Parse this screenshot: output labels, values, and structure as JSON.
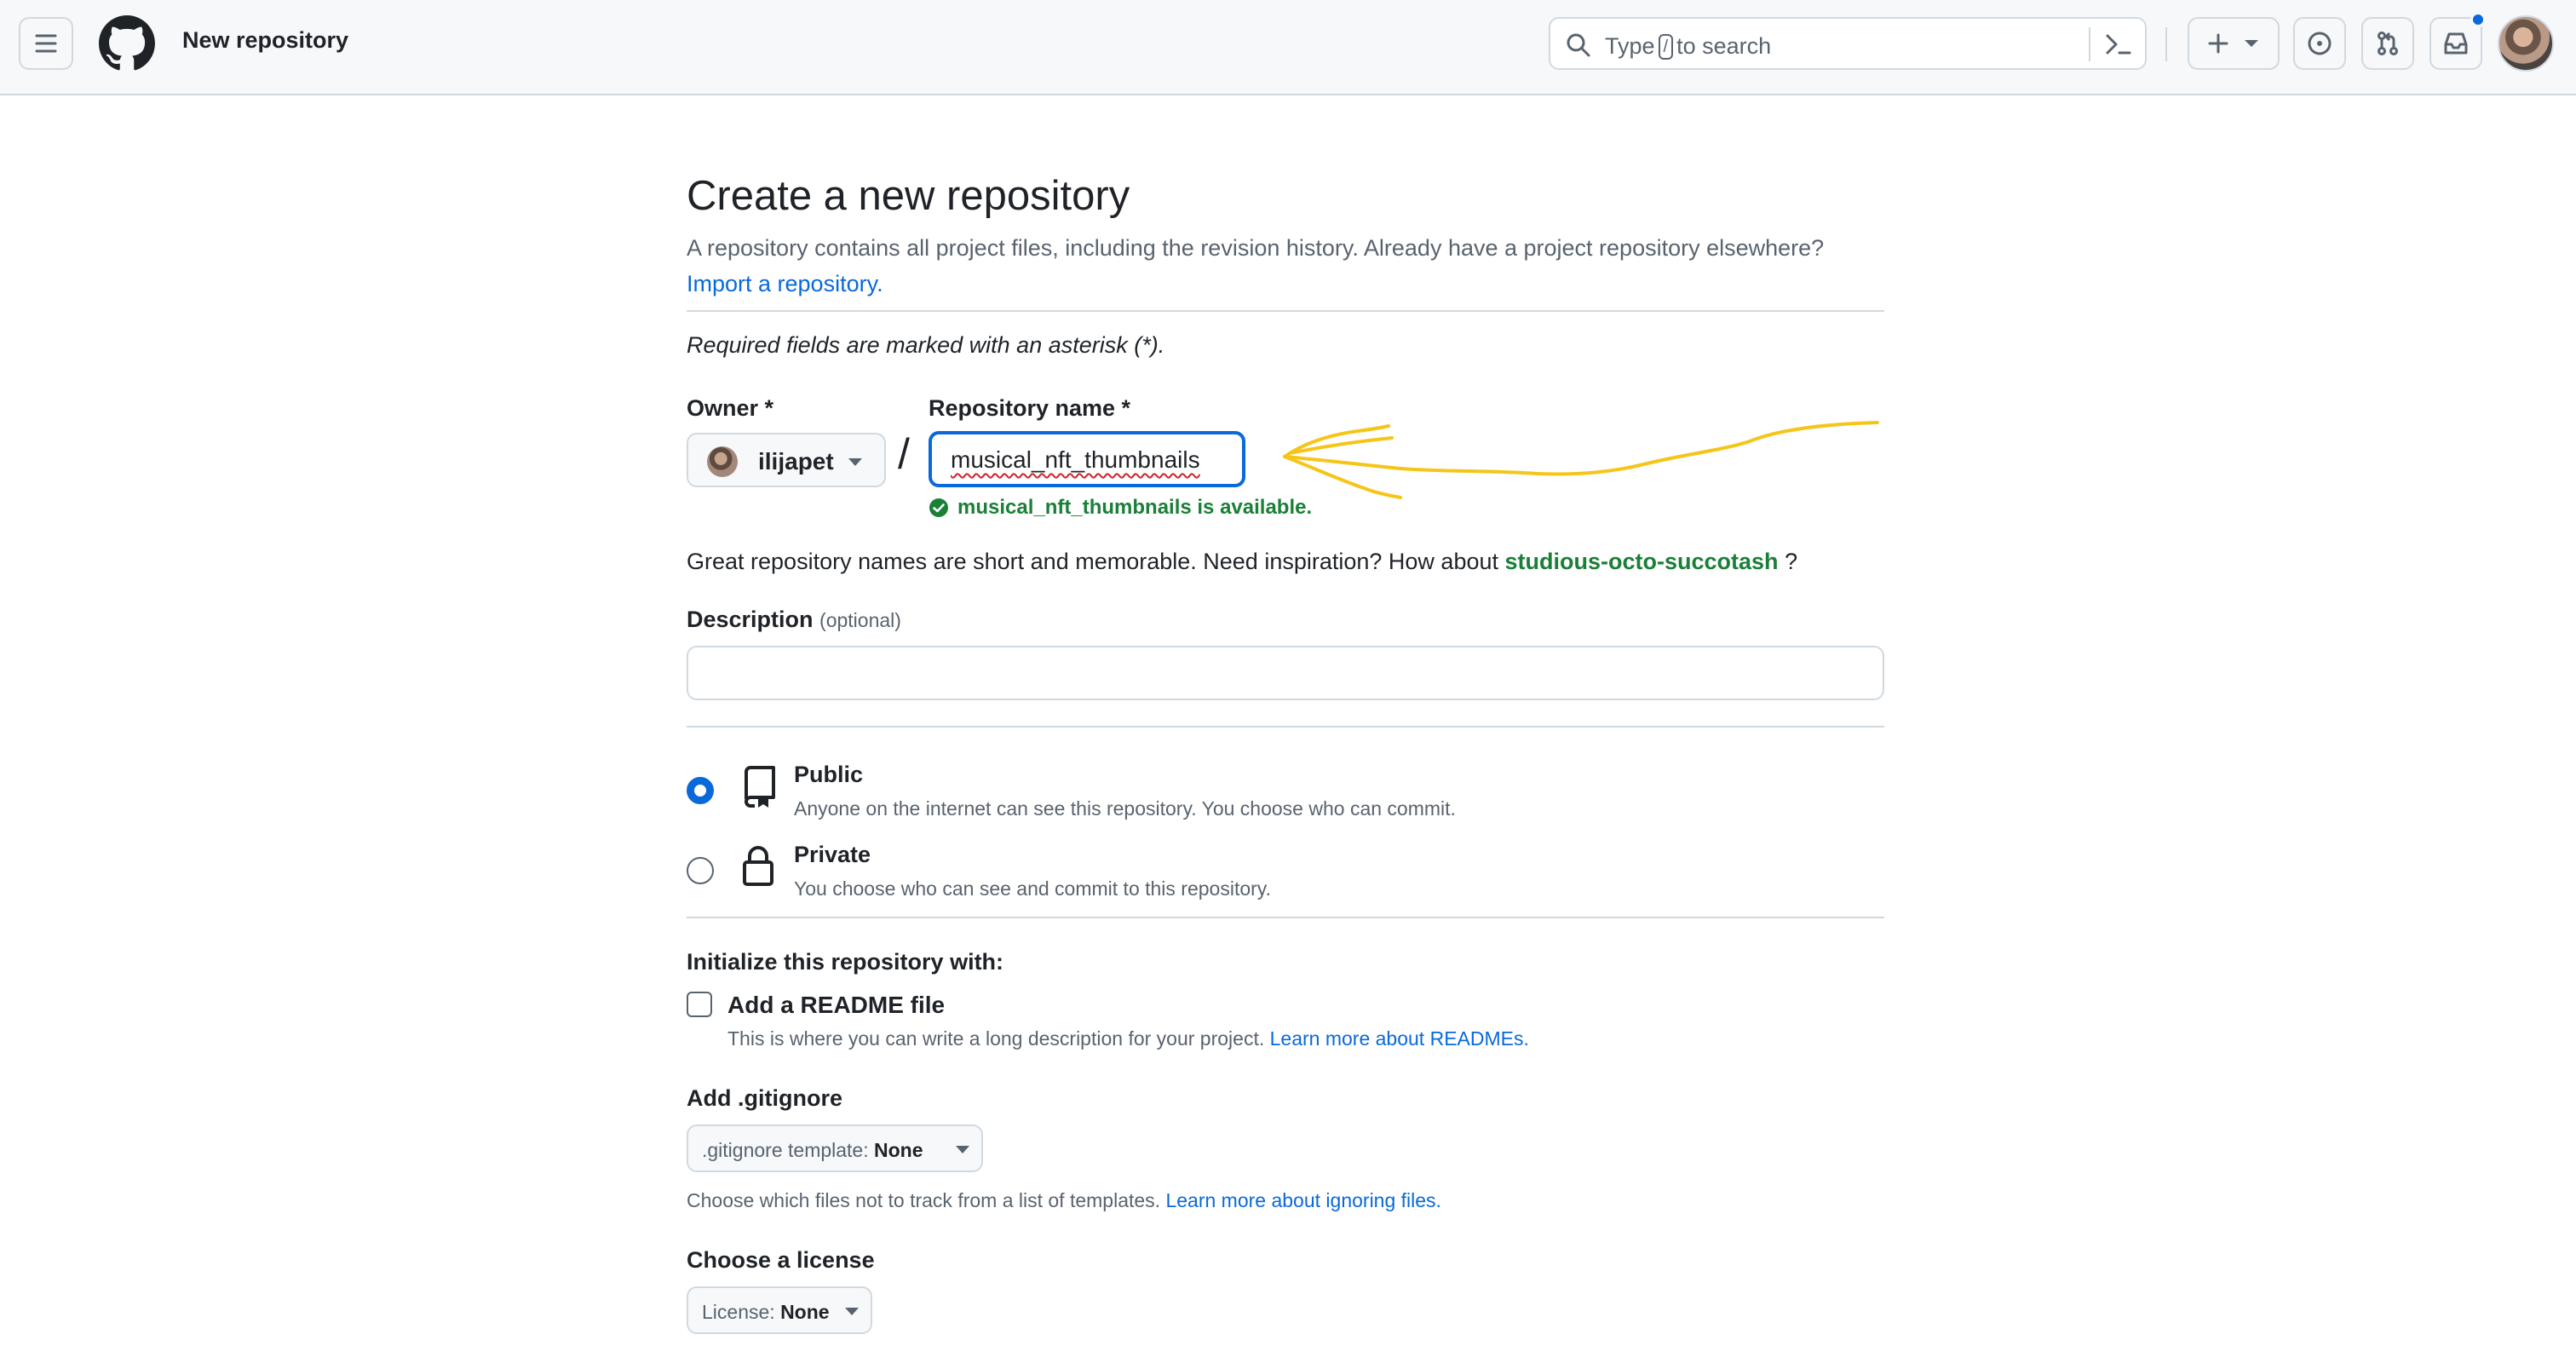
{
  "header": {
    "context_title": "New repository",
    "search_prefix": "Type",
    "search_key": "/",
    "search_suffix": "to search"
  },
  "page": {
    "title": "Create a new repository",
    "subtitle": "A repository contains all project files, including the revision history. Already have a project repository elsewhere?",
    "import_link": "Import a repository.",
    "required_note": "Required fields are marked with an asterisk (*)."
  },
  "owner": {
    "label": "Owner *",
    "value": "ilijapet"
  },
  "separator": "/",
  "repo_name": {
    "label": "Repository name *",
    "value": "musical_nft_thumbnails",
    "availability": "musical_nft_thumbnails is available."
  },
  "inspiration": {
    "text": "Great repository names are short and memorable. Need inspiration? How about",
    "suggestion": "studious-octo-succotash",
    "suffix": "?"
  },
  "description": {
    "label": "Description",
    "optional": "(optional)",
    "value": ""
  },
  "visibility": {
    "selected": "Public",
    "options": [
      {
        "name": "Public",
        "description": "Anyone on the internet can see this repository. You choose who can commit."
      },
      {
        "name": "Private",
        "description": "You choose who can see and commit to this repository."
      }
    ]
  },
  "initialize": {
    "title": "Initialize this repository with:",
    "readme_label": "Add a README file",
    "readme_checked": false,
    "readme_desc": "This is where you can write a long description for your project.",
    "readme_link": "Learn more about READMEs."
  },
  "gitignore": {
    "title": "Add .gitignore",
    "button_prefix": ".gitignore template:",
    "button_value": "None",
    "note": "Choose which files not to track from a list of templates.",
    "note_link": "Learn more about ignoring files."
  },
  "license": {
    "title": "Choose a license",
    "button_prefix": "License:",
    "button_value": "None"
  },
  "colors": {
    "accent": "#0969da",
    "success": "#1a7f37",
    "annotation": "#f5c518"
  },
  "icons": [
    "menu-icon",
    "github-logo-icon",
    "search-icon",
    "command-palette-icon",
    "plus-icon",
    "caret-down-icon",
    "issue-icon",
    "pull-request-icon",
    "inbox-icon",
    "check-circle-icon",
    "repo-icon",
    "lock-icon"
  ]
}
